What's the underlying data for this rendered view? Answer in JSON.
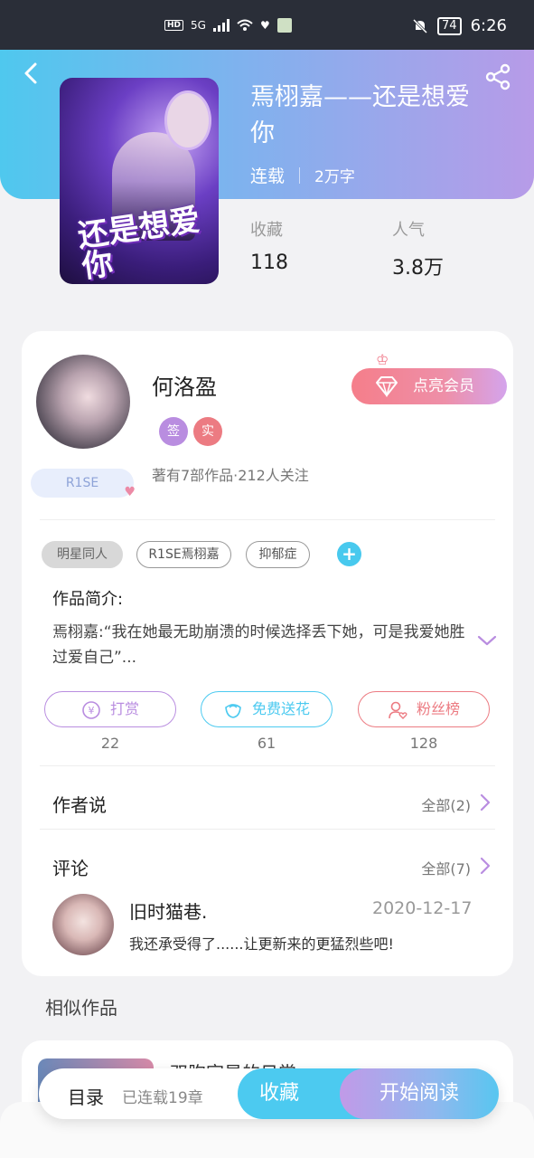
{
  "status_bar": {
    "time": "6:26",
    "battery": "74",
    "hd": "HD",
    "network": "5G"
  },
  "book": {
    "title": "焉栩嘉——还是想爱你",
    "status": "连载",
    "word_count": "2万字",
    "cover_text": "还是想爱你",
    "stats": [
      {
        "label": "收藏",
        "value": "118"
      },
      {
        "label": "人气",
        "value": "3.8万"
      }
    ]
  },
  "author": {
    "name": "何洛盈",
    "badges": [
      "签",
      "实"
    ],
    "fan_badge": "R1SE",
    "info": "著有7部作品·212人关注",
    "vip_button": "点亮会员"
  },
  "tags": [
    "明星同人",
    "R1SE焉栩嘉",
    "抑郁症"
  ],
  "intro": {
    "title": "作品简介:",
    "text": "焉栩嘉:“我在她最无助崩溃的时候选择丢下她，可是我爱她胜过爱自己”..."
  },
  "actions": [
    {
      "label": "打赏",
      "count": "22",
      "color": "#b98de0"
    },
    {
      "label": "免费送花",
      "count": "61",
      "color": "#4ccaf0"
    },
    {
      "label": "粉丝榜",
      "count": "128",
      "color": "#ec7b82"
    }
  ],
  "author_says": {
    "title": "作者说",
    "more": "全部(2)"
  },
  "comments": {
    "title": "评论",
    "more": "全部(7)",
    "items": [
      {
        "user": "旧时猫巷.",
        "date": "2020-12-17",
        "text": "我还承受得了......让更新来的更猛烈些吧!"
      }
    ]
  },
  "similar": {
    "title": "相似作品",
    "first_title": "双胞宗星的日常"
  },
  "bottom_bar": {
    "toc_label": "目录",
    "toc_count": "已连载19章",
    "collect": "收藏",
    "read": "开始阅读"
  },
  "colors": {
    "accent_blue": "#4ccaf0",
    "accent_purple": "#b79be8",
    "vip_pink": "#f57e8a"
  }
}
